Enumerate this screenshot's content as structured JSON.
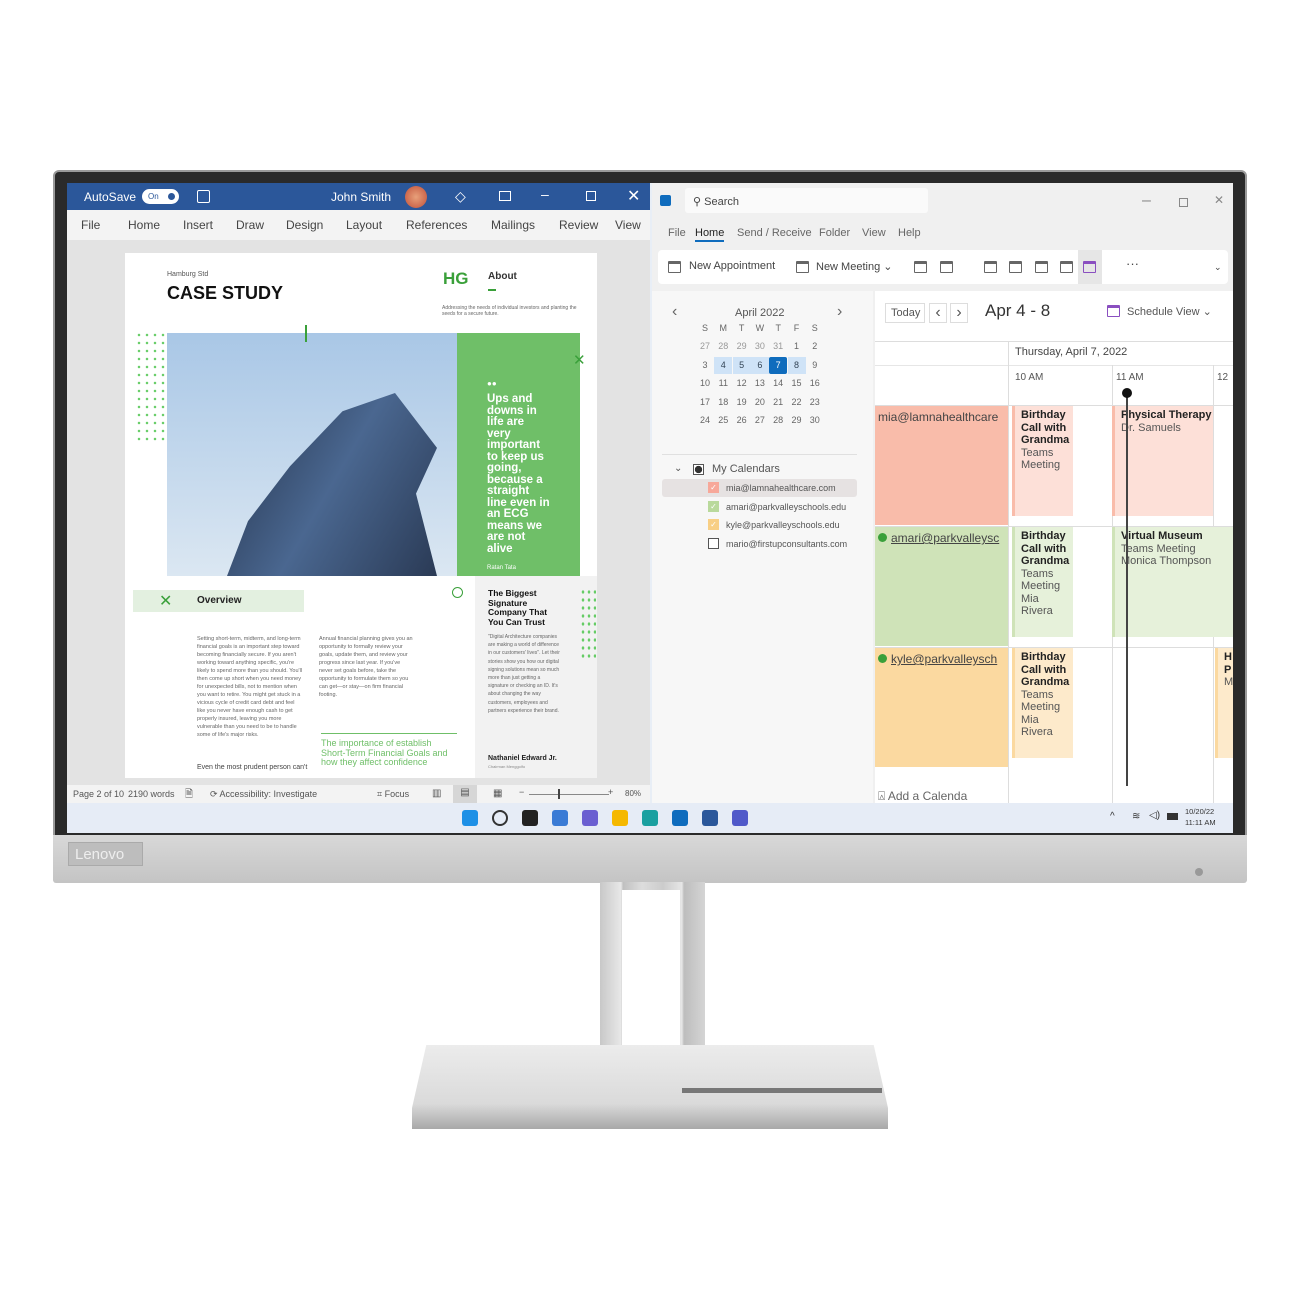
{
  "device": {
    "brand": "Lenovo"
  },
  "word": {
    "autosave": "AutoSave",
    "toggle": "On",
    "user": "John Smith",
    "menu": [
      "File",
      "Home",
      "Insert",
      "Draw",
      "Design",
      "Layout",
      "References",
      "Mailings",
      "Review",
      "View"
    ],
    "page": {
      "kicker": "Hamburg Std",
      "title": "CASE STUDY",
      "logo": "HG",
      "about": "About",
      "about_text": "Addressing the needs of individual investors and planting the seeds for a secure future.",
      "quote": "Ups and downs in life are very important to keep us going, because a straight line even in an ECG means we are not alive",
      "quote_author": "Ratan Tata",
      "overview": "Overview",
      "col1": "Setting short-term, midterm, and long-term financial goals is an important step toward becoming financially secure. If you aren't working toward anything specific, you're likely to spend more than you should. You'll then come up short when you need money for unexpected bills, not to mention when you want to retire. You might get stuck in a vicious cycle of credit card debt and feel like you never have enough cash to get properly insured, leaving you more vulnerable than you need to be to handle some of life's major risks.",
      "col1b": "Even the most prudent person can't",
      "col2": "Annual financial planning gives you an opportunity to formally review your goals, update them, and review your progress since last year. If you've never set goals before, take the opportunity to formulate them so you can get—or stay—on firm financial footing.",
      "pull": "The importance of establish Short-Term Financial Goals and how they affect confidence",
      "side_title": "The Biggest Signature Company That You Can Trust",
      "side_text": "\"Digital Architecture companies are making a world of difference in our customers' lives\". Let their stories show you how our digital signing solutions mean so much more than just getting a signature or checking an ID. It's about changing the way customers, employees and partners experience their brand.",
      "side_author": "Nathaniel Edward Jr.",
      "side_role": "Chairman Menggolfo"
    },
    "status": {
      "page": "Page 2 of 10",
      "words": "2190 words",
      "accessibility": "Accessibility: Investigate",
      "focus": "Focus",
      "zoom": "80%",
      "zoom_level": 80
    }
  },
  "outlook": {
    "search": "Search",
    "tabs": [
      "File",
      "Home",
      "Send / Receive",
      "Folder",
      "View",
      "Help"
    ],
    "active_tab": "Home",
    "new_appointment": "New Appointment",
    "new_meeting": "New Meeting",
    "more": "···",
    "mini_cal": {
      "month": "April 2022",
      "days": [
        "S",
        "M",
        "T",
        "W",
        "T",
        "F",
        "S"
      ],
      "weeks": [
        [
          "27",
          "28",
          "29",
          "30",
          "31",
          "1",
          "2"
        ],
        [
          "3",
          "4",
          "5",
          "6",
          "7",
          "8",
          "9"
        ],
        [
          "10",
          "11",
          "12",
          "13",
          "14",
          "15",
          "16"
        ],
        [
          "17",
          "18",
          "19",
          "20",
          "21",
          "22",
          "23"
        ],
        [
          "24",
          "25",
          "26",
          "27",
          "28",
          "29",
          "30"
        ]
      ],
      "selected": "7",
      "week_range": [
        "4",
        "8"
      ]
    },
    "my_calendars": "My Calendars",
    "calendars": [
      {
        "name": "mia@lamnahealthcare.com",
        "color": "#f7a89a",
        "checked": true
      },
      {
        "name": "amari@parkvalleyschools.edu",
        "color": "#b9d99c",
        "checked": true
      },
      {
        "name": "kyle@parkvalleyschools.edu",
        "color": "#f8cf85",
        "checked": true
      },
      {
        "name": "mario@firstupconsultants.com",
        "color": "#ffffff",
        "checked": false
      }
    ],
    "today": "Today",
    "range": "Apr 4 - 8",
    "view": "Schedule View",
    "date_header": "Thursday, April 7, 2022",
    "times": [
      "10 AM",
      "11 AM",
      "12"
    ],
    "rows": [
      {
        "label": "mia@lamnahealthcare",
        "bg": "#f9bcaa",
        "light": "#fde0d8",
        "events": [
          {
            "title": "Birthday Call with Grandma",
            "sub": "Teams Meeting"
          },
          {
            "title": "Physical Therapy",
            "sub": "Dr. Samuels"
          }
        ]
      },
      {
        "label": "amari@parkvalleysc",
        "bg": "#cfe3b8",
        "light": "#e6f1da",
        "events": [
          {
            "title": "Birthday Call with Grandma",
            "sub": "Teams Meeting Mia Rivera"
          },
          {
            "title": "Virtual Museum",
            "sub": "Teams Meeting Monica Thompson"
          }
        ]
      },
      {
        "label": "kyle@parkvalleysch",
        "bg": "#fbd9a0",
        "light": "#fdeacb",
        "events": [
          {
            "title": "Birthday Call with Grandma",
            "sub": "Teams Meeting Mia Rivera"
          },
          {
            "title": "H P",
            "sub": "M"
          }
        ]
      }
    ],
    "add_calendar": "Add a Calenda"
  },
  "taskbar": {
    "icons": [
      "windows-start",
      "search",
      "task-view",
      "widgets",
      "teams-chat",
      "file-explorer",
      "edge",
      "store",
      "word",
      "teams"
    ],
    "date": "10/20/22",
    "time": "11:11 AM"
  }
}
